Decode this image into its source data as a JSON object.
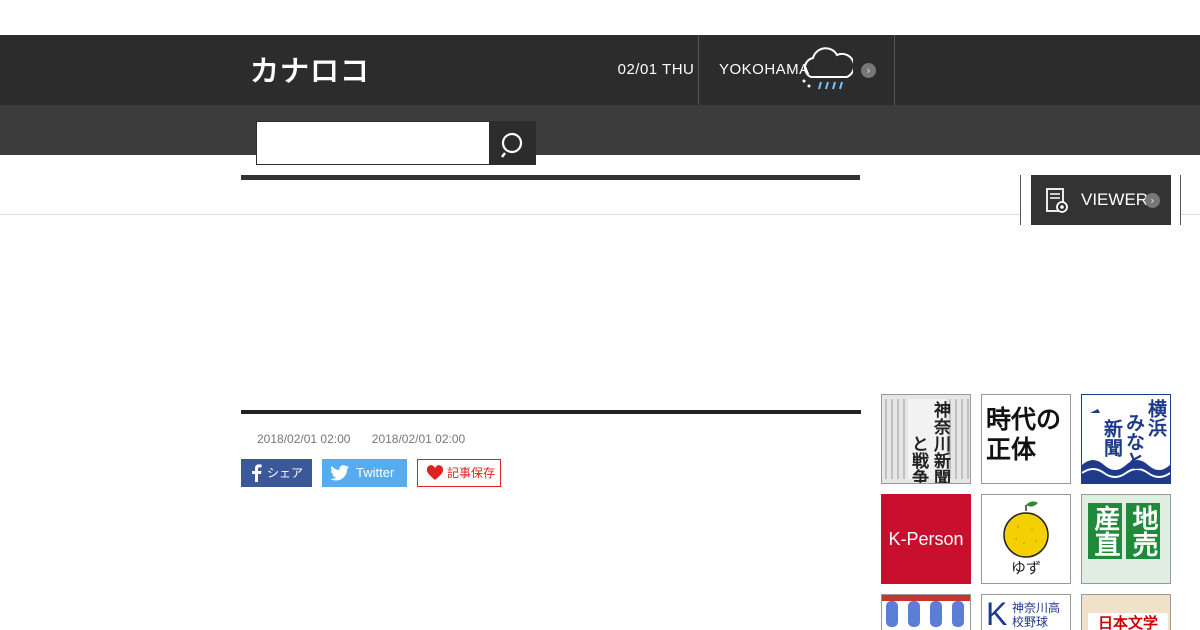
{
  "header": {
    "logo": "カナロコ",
    "date": "02/01 THU",
    "city": "YOKOHAMA"
  },
  "search": {
    "placeholder": ""
  },
  "viewer": {
    "label": "VIEWER"
  },
  "article": {
    "dates": [
      "2018/02/01 02:00",
      "2018/02/01 02:00"
    ],
    "share": {
      "facebook": "シェア",
      "twitter": "Twitter",
      "save": "記事保存"
    }
  },
  "banners": [
    {
      "text": "神奈川新聞と戦争",
      "title_a": "神奈川新聞",
      "title_b": "と戦争"
    },
    {
      "line1": "時代の",
      "line2": "正体"
    },
    {
      "col1": "横浜",
      "col2": "みなと",
      "col3": "新聞"
    },
    {
      "text": "K-Person",
      "color": "#c8102e"
    },
    {
      "text": "ゆず"
    },
    {
      "col1": "地売",
      "col2": "産直"
    },
    {
      "text": ""
    },
    {
      "text": "神奈川高校野球",
      "letter": "K"
    },
    {
      "text": "日本文学"
    }
  ],
  "colors": {
    "header": "#2c2c2c",
    "search_bar": "#3c3c3c",
    "facebook": "#3b5998",
    "twitter": "#55acee",
    "save": "#dd2222"
  }
}
